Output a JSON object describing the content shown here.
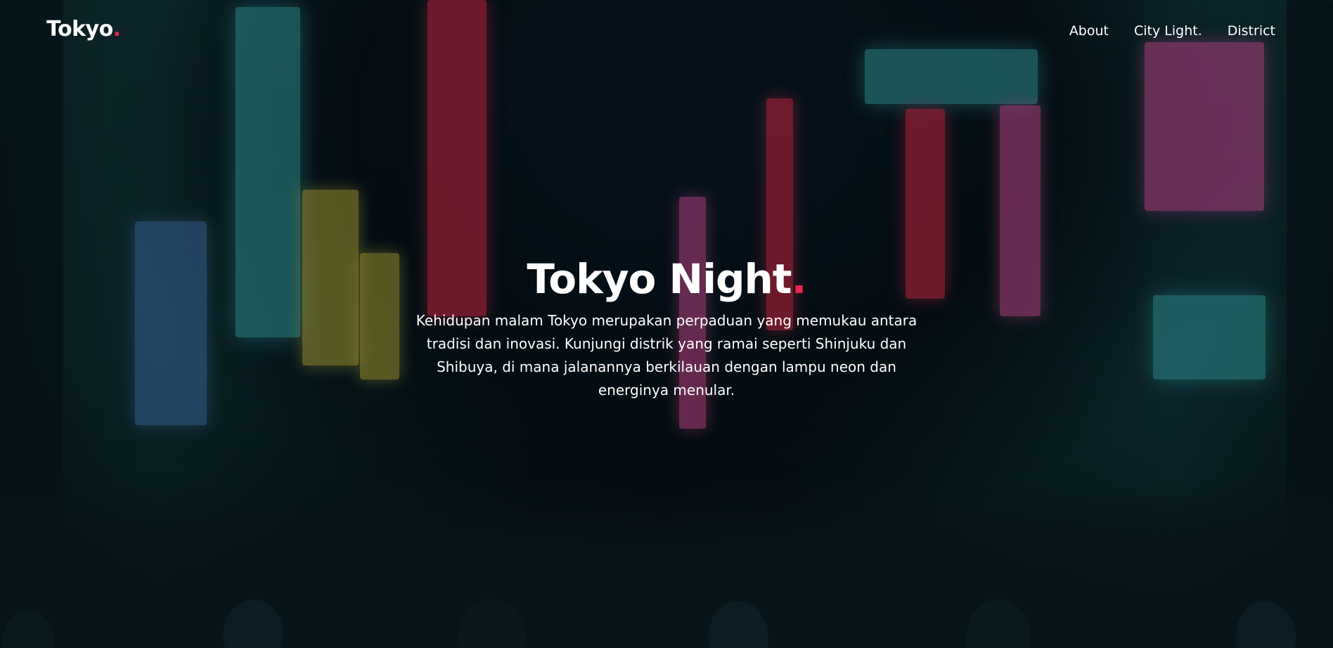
{
  "navbar": {
    "brand": "Tokyo",
    "brand_dot": ".",
    "links": [
      "About",
      "City Light.",
      "District"
    ]
  },
  "hero": {
    "title": "Tokyo Night",
    "title_dot": ".",
    "description": "Kehidupan malam Tokyo merupakan perpaduan yang memukau antara tradisi dan inovasi. Kunjungi distrik yang ramai seperti Shinjuku dan Shibuya, di mana jalanannya berkilauan dengan lampu neon dan energinya menular."
  },
  "colors": {
    "accent": "#e8264b",
    "text": "#ffffff"
  }
}
